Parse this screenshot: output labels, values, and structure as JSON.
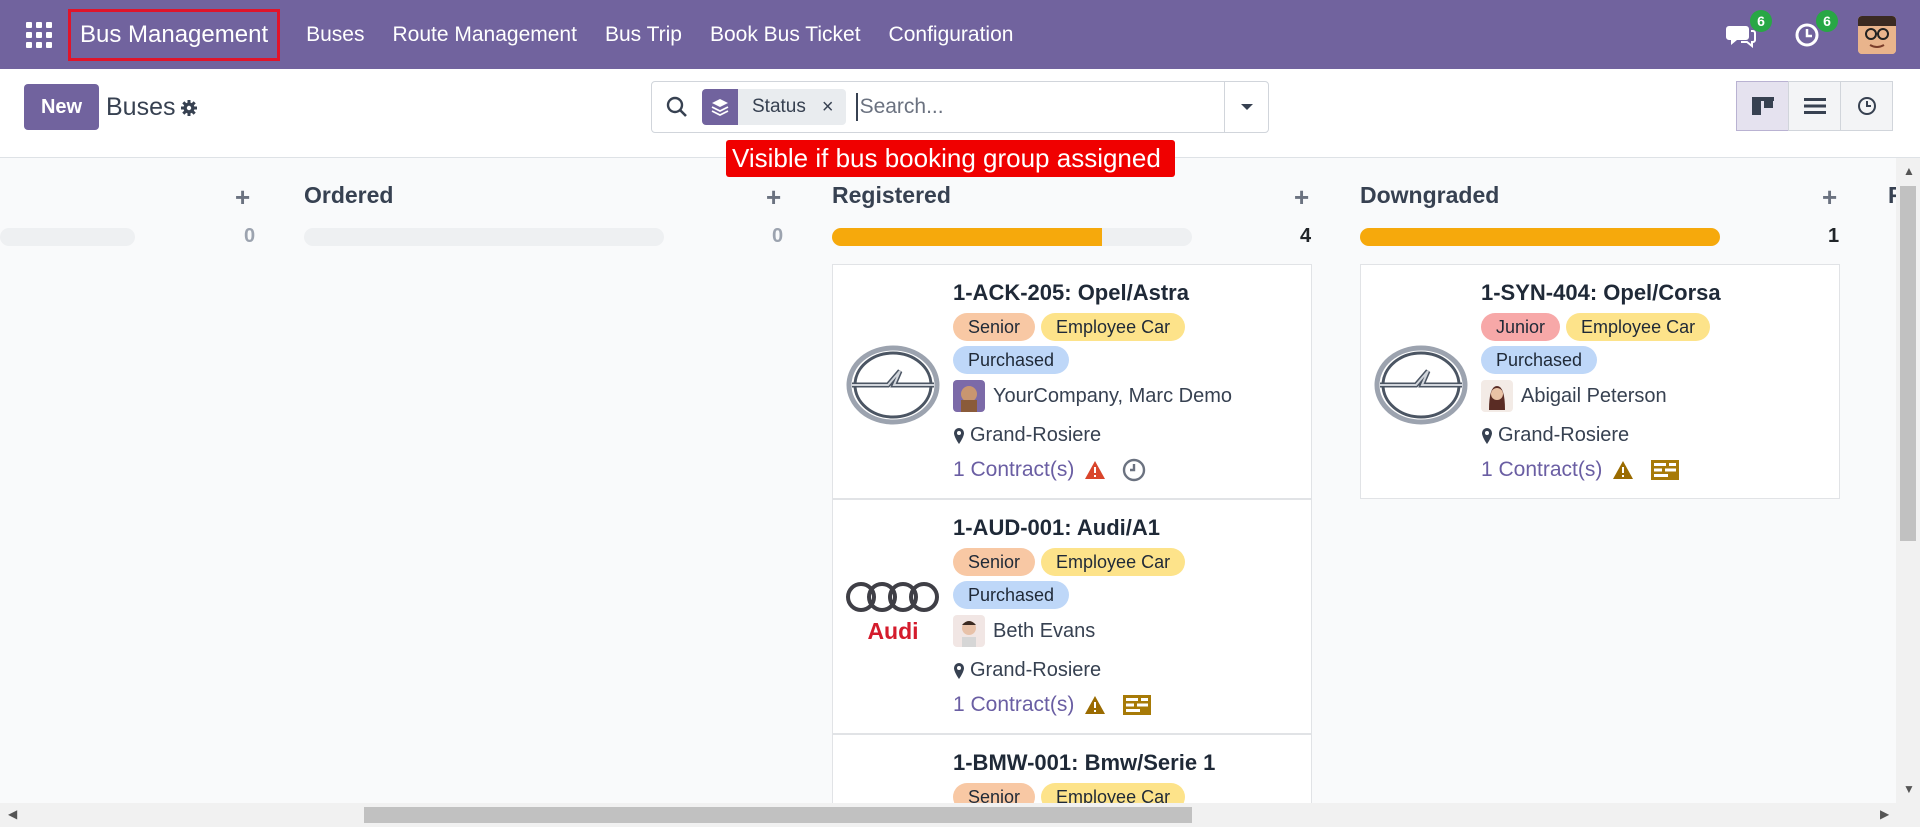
{
  "navbar": {
    "brand": "Bus Management",
    "menu": [
      "Buses",
      "Route Management",
      "Bus Trip",
      "Book Bus Ticket",
      "Configuration"
    ],
    "messages_count": "6",
    "activities_count": "6"
  },
  "control": {
    "new_label": "New",
    "breadcrumb": "Buses",
    "facet_label": "Status",
    "search_placeholder": "Search..."
  },
  "annotation": "Visible if bus booking group assigned",
  "columns": [
    {
      "title": "",
      "count": "0",
      "progress": 0
    },
    {
      "title": "Ordered",
      "count": "0",
      "progress": 0
    },
    {
      "title": "Registered",
      "count": "4",
      "progress": 0.75
    },
    {
      "title": "Downgraded",
      "count": "1",
      "progress": 1.0
    },
    {
      "title": "F",
      "count": "",
      "progress": 0
    }
  ],
  "cards": {
    "registered": [
      {
        "title": "1-ACK-205: Opel/Astra",
        "tags": [
          "Senior",
          "Employee Car",
          "Purchased"
        ],
        "driver": "YourCompany, Marc Demo",
        "location": "Grand-Rosiere",
        "contracts": "1 Contract(s)",
        "logo": "opel-logo"
      },
      {
        "title": "1-AUD-001: Audi/A1",
        "tags": [
          "Senior",
          "Employee Car",
          "Purchased"
        ],
        "driver": "Beth Evans",
        "location": "Grand-Rosiere",
        "contracts": "1 Contract(s)",
        "logo": "audi-logo",
        "logo_text": "Audi"
      },
      {
        "title": "1-BMW-001: Bmw/Serie 1",
        "tags": [
          "Senior",
          "Employee Car"
        ]
      }
    ],
    "downgraded": [
      {
        "title": "1-SYN-404: Opel/Corsa",
        "tags": [
          "Junior",
          "Employee Car",
          "Purchased"
        ],
        "driver": "Abigail Peterson",
        "location": "Grand-Rosiere",
        "contracts": "1 Contract(s)",
        "logo": "opel-logo"
      }
    ]
  },
  "colors": {
    "navbar": "#71639e",
    "progress": "#f6a90c",
    "annotation": "#f00000"
  }
}
